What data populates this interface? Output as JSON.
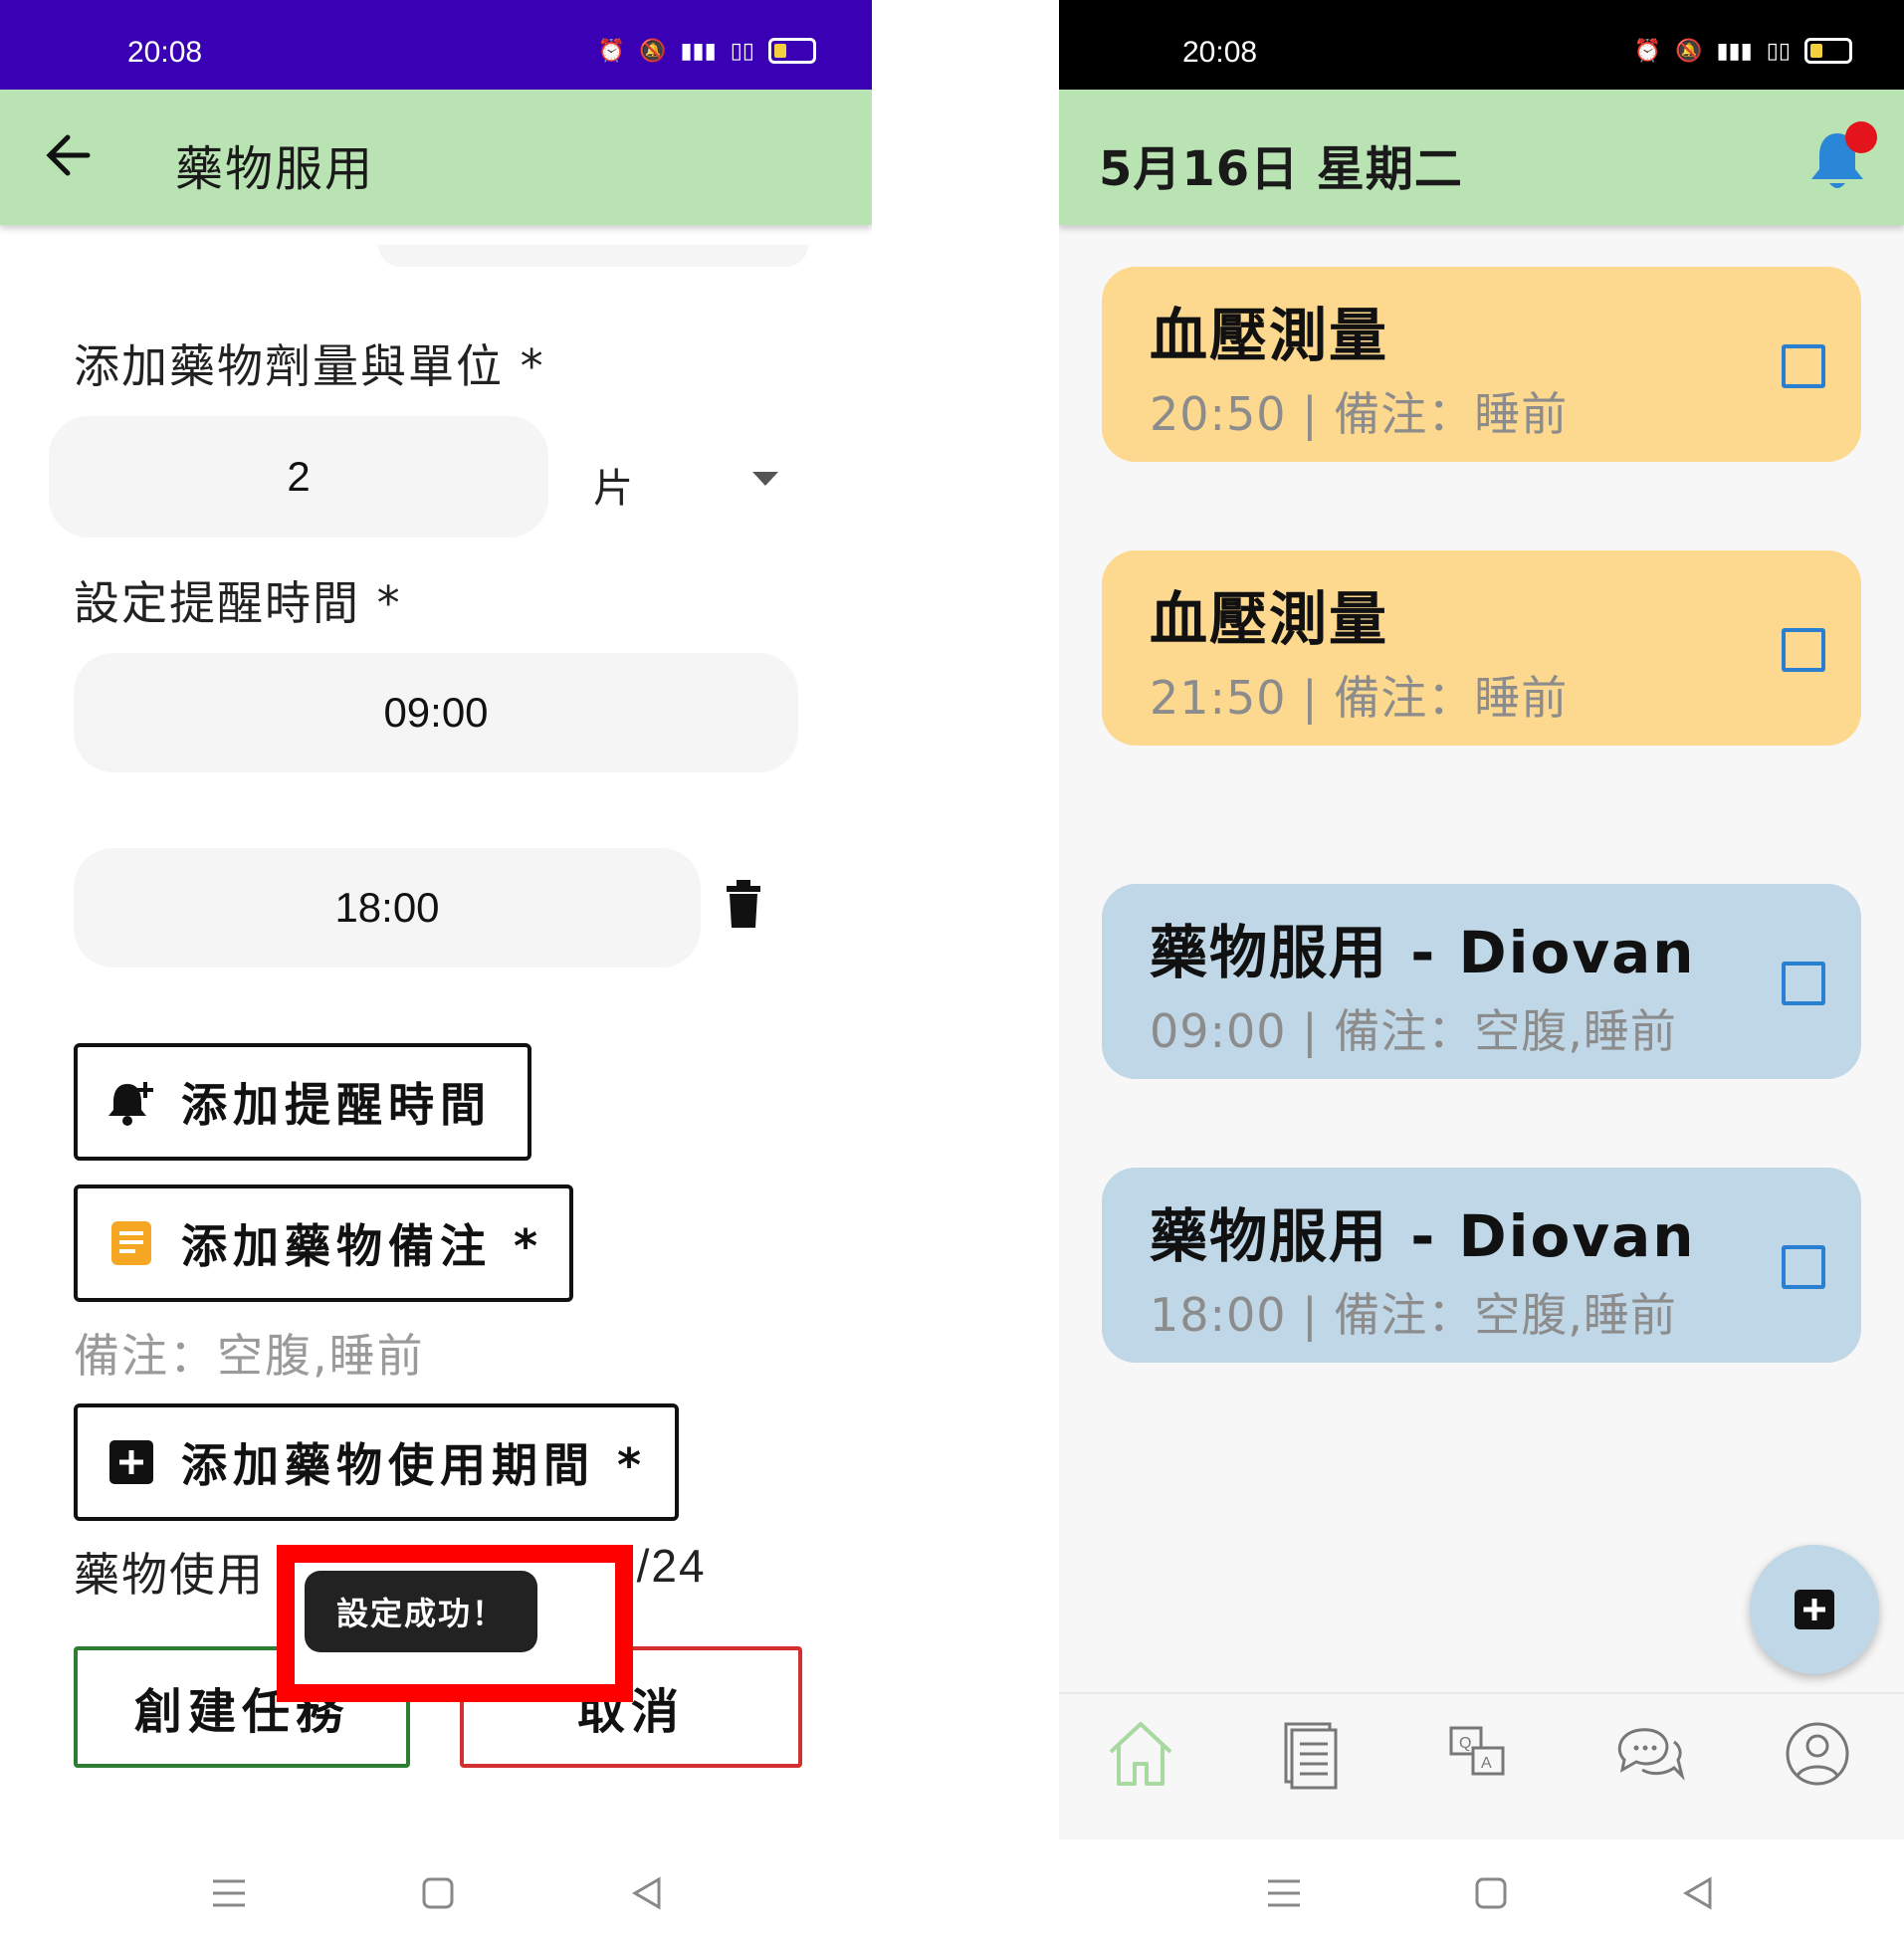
{
  "left": {
    "status": {
      "time": "20:08",
      "bg": "#3a00b4"
    },
    "appbar": {
      "title": "藥物服用"
    },
    "dose": {
      "label": "添加藥物劑量與單位 *",
      "value": "2",
      "unit": "片"
    },
    "reminder": {
      "label": "設定提醒時間 *",
      "times": [
        "09:00",
        "18:00"
      ]
    },
    "buttons": {
      "add_reminder": "添加提醒時間",
      "add_note": "添加藥物備注 *",
      "add_period": "添加藥物使用期間 *"
    },
    "note_text": "備注：空腹,睡前",
    "period_text_left": "藥物使用",
    "period_text_right": "5/24",
    "toast": "設定成功！",
    "create_button": "創建任務",
    "cancel_button": "取消",
    "colors": {
      "create": "#2e7d32",
      "cancel": "#d32f2f",
      "highlight": "#ff0000",
      "note_icon": "#f5a623"
    }
  },
  "right": {
    "status": {
      "time": "20:08",
      "bg": "#000000"
    },
    "appbar": {
      "title": "5月16日 星期二"
    },
    "cards": [
      {
        "title": "血壓測量",
        "subtitle": "20:50 | 備注：睡前",
        "color": "#fdd88f"
      },
      {
        "title": "血壓測量",
        "subtitle": "21:50 | 備注：睡前",
        "color": "#fdd88f"
      },
      {
        "title": "藥物服用 - Diovan",
        "subtitle": "09:00 | 備注：空腹,睡前",
        "color": "#bfd7e6"
      },
      {
        "title": "藥物服用 - Diovan",
        "subtitle": "18:00 | 備注：空腹,睡前",
        "color": "#bfd7e6"
      }
    ],
    "nav": [
      "home-icon",
      "document-icon",
      "qa-icon",
      "chat-icon",
      "profile-icon"
    ]
  }
}
